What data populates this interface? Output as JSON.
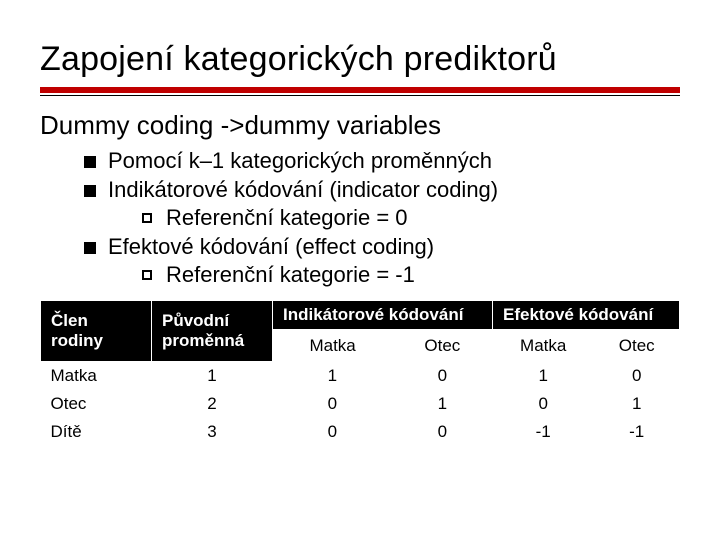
{
  "title": "Zapojení kategorických prediktorů",
  "subtitle": "Dummy coding ->dummy variables",
  "bullets": {
    "b1": "Pomocí k–1 kategorických proměnných",
    "b2": "Indikátorové kódování (indicator coding)",
    "b2a": "Referenční kategorie = 0",
    "b3": "Efektové kódování (effect coding)",
    "b3a": "Referenční kategorie = -1"
  },
  "table": {
    "head": {
      "c1": "Člen rodiny",
      "c2": "Původní proměnná",
      "c3": "Indikátorové kódování",
      "c4": "Efektové kódování"
    },
    "sub": {
      "s1": "Matka",
      "s2": "Otec",
      "s3": "Matka",
      "s4": "Otec"
    },
    "rows": [
      {
        "label": "Matka",
        "orig": "1",
        "i1": "1",
        "i2": "0",
        "e1": "1",
        "e2": "0"
      },
      {
        "label": "Otec",
        "orig": "2",
        "i1": "0",
        "i2": "1",
        "e1": "0",
        "e2": "1"
      },
      {
        "label": "Dítě",
        "orig": "3",
        "i1": "0",
        "i2": "0",
        "e1": "-1",
        "e2": "-1"
      }
    ]
  },
  "chart_data": {
    "type": "table",
    "title": "Dummy coding – indicator vs effect coding",
    "columns": [
      "Člen rodiny",
      "Původní proměnná",
      "Indikátorové: Matka",
      "Indikátorové: Otec",
      "Efektové: Matka",
      "Efektové: Otec"
    ],
    "rows": [
      [
        "Matka",
        1,
        1,
        0,
        1,
        0
      ],
      [
        "Otec",
        2,
        0,
        1,
        0,
        1
      ],
      [
        "Dítě",
        3,
        0,
        0,
        -1,
        -1
      ]
    ]
  }
}
